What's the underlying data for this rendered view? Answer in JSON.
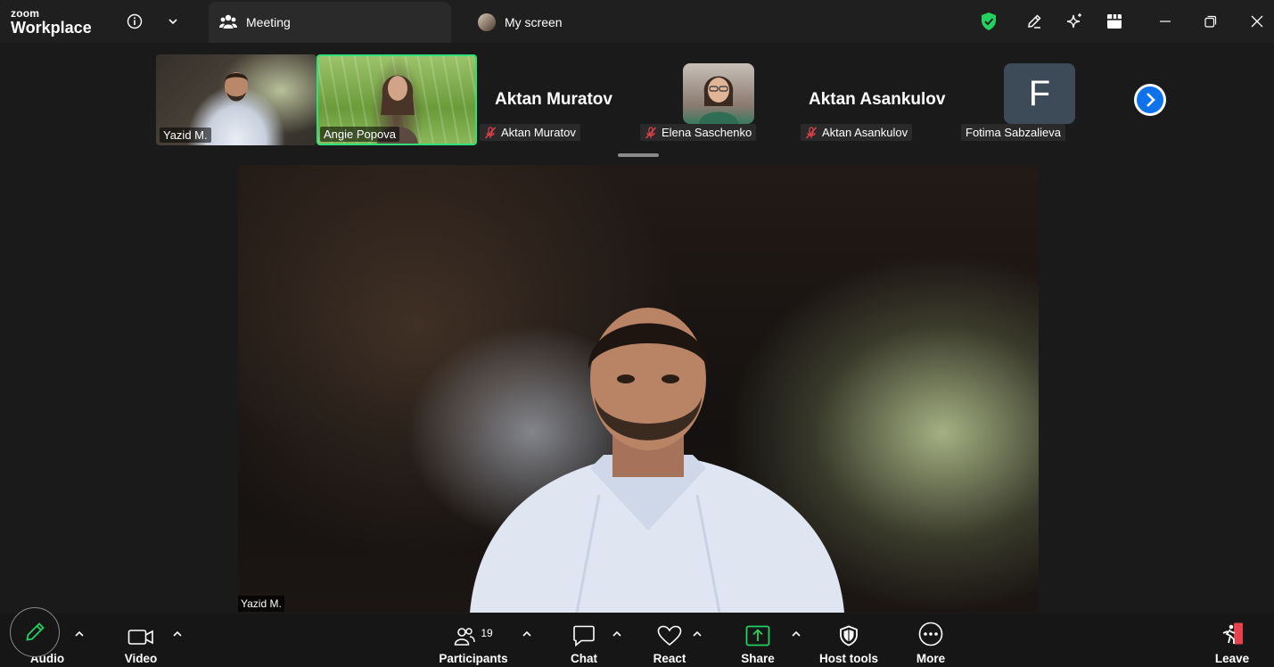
{
  "app": {
    "logo_line1": "zoom",
    "logo_line2": "Workplace"
  },
  "tabs": [
    {
      "label": "Meeting",
      "active": true
    },
    {
      "label": "My screen",
      "active": false
    }
  ],
  "gallery": [
    {
      "name": "Yazid M.",
      "muted": false
    },
    {
      "name": "Angie Popova",
      "muted": false,
      "speaking": true
    },
    {
      "name": "Aktan Muratov",
      "display_name": "Aktan Muratov",
      "muted": true
    },
    {
      "name": "Elena Saschenko",
      "muted": true
    },
    {
      "name": "Aktan Asankulov",
      "display_name": "Aktan Asankulov",
      "muted": true
    },
    {
      "name": "Fotima Sabzalieva",
      "initial": "F",
      "muted": false
    }
  ],
  "main_video": {
    "name": "Yazid M."
  },
  "toolbar": {
    "audio": "Audio",
    "video": "Video",
    "participants": "Participants",
    "participants_count": "19",
    "chat": "Chat",
    "react": "React",
    "share": "Share",
    "host_tools": "Host tools",
    "more": "More",
    "leave": "Leave"
  },
  "colors": {
    "accent_green": "#23d160",
    "speaker_border": "#2ee07a",
    "leave_red": "#e5424d",
    "next_blue": "#0e72ed"
  },
  "icons": [
    "info-icon",
    "chevron-down-icon",
    "people-icon",
    "shield-check-icon",
    "pencil-icon",
    "sparkle-icon",
    "grid-icon",
    "minimize-icon",
    "restore-icon",
    "close-icon",
    "mic-off-icon",
    "next-page-icon",
    "pencil-annotate-icon",
    "video-camera-icon",
    "participants-icon",
    "chat-icon",
    "heart-icon",
    "share-up-icon",
    "host-shield-icon",
    "more-dots-icon",
    "leave-door-icon"
  ]
}
